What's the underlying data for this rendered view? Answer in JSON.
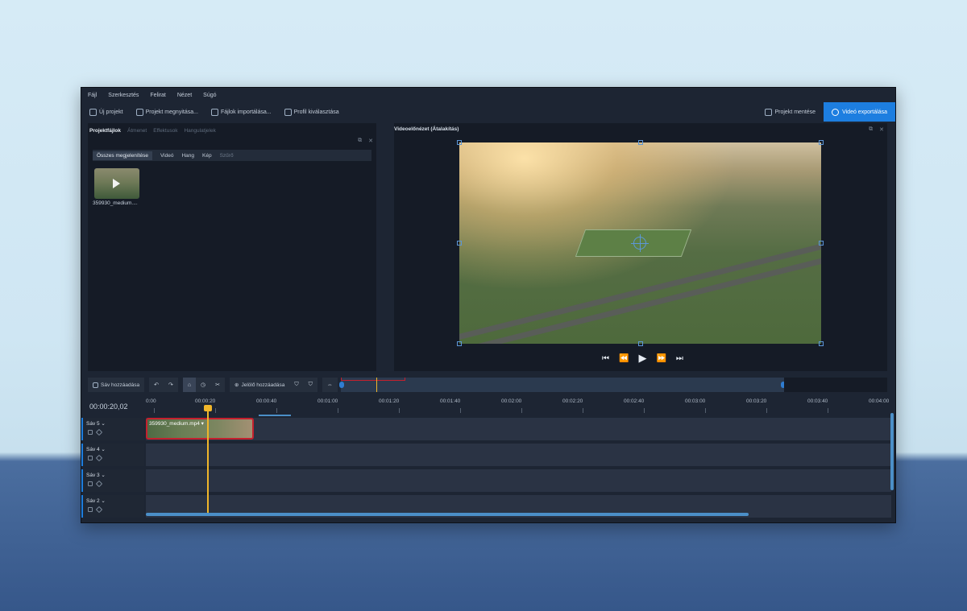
{
  "menu": [
    "Fájl",
    "Szerkesztés",
    "Felirat",
    "Nézet",
    "Súgó"
  ],
  "toolbar": {
    "new_project": "Új projekt",
    "open_project": "Projekt megnyitása...",
    "import_files": "Fájlok importálása...",
    "choose_profile": "Profil kiválasztása",
    "save_project": "Projekt mentése",
    "export_video": "Videó exportálása"
  },
  "left_panel": {
    "tabs": [
      "Projektfájlok",
      "Átmenet",
      "Effektusok",
      "Hangulatjelek"
    ],
    "filters": [
      "Összes megjelenítése",
      "Videó",
      "Hang",
      "Kép"
    ],
    "filter_placeholder": "Szűrő",
    "file_name": "359930_medium...."
  },
  "preview": {
    "title": "Videoelőnézet (Átalakítás)"
  },
  "timeline": {
    "add_track": "Sáv hozzáadása",
    "add_marker": "Jelölő hozzáadása",
    "timecode": "00:00:20,02",
    "ruler": [
      "0:00",
      "00:00:20",
      "00:00:40",
      "00:01:00",
      "00:01:20",
      "00:01:40",
      "00:02:00",
      "00:02:20",
      "00:02:40",
      "00:03:00",
      "00:03:20",
      "00:03:40",
      "00:04:00"
    ],
    "tracks": [
      "Sáv 5",
      "Sáv 4",
      "Sáv 3",
      "Sáv 2"
    ],
    "clip_name": "359930_medium.mp4"
  },
  "colors": {
    "accent": "#1d7ee0",
    "clip_border": "#c4202e",
    "playhead": "#f0b62a"
  }
}
